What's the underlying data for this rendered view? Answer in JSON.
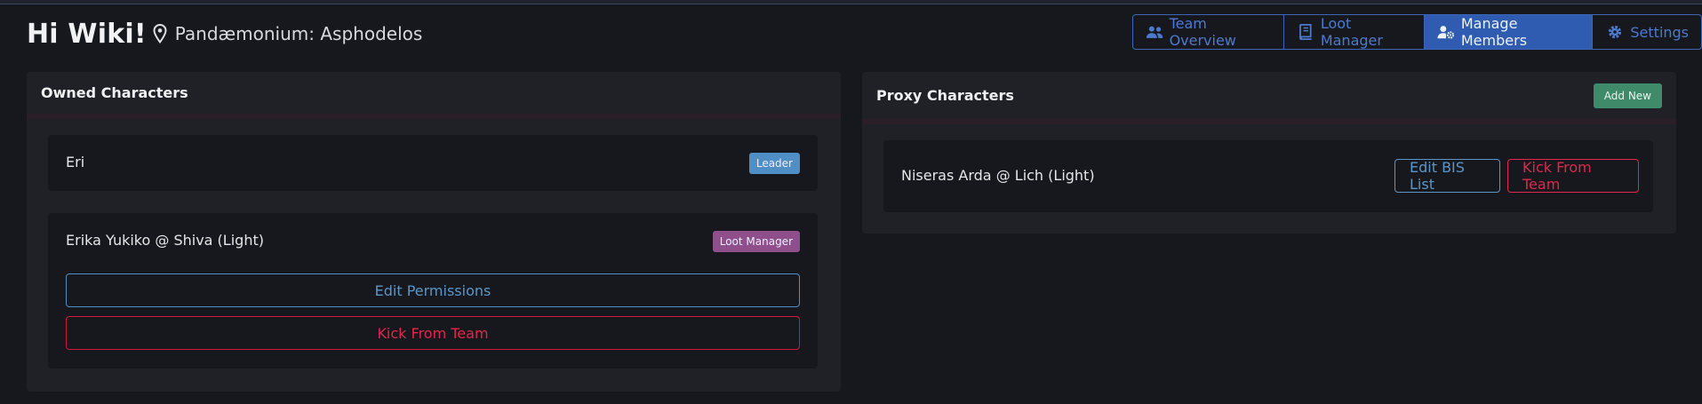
{
  "header": {
    "greeting": "Hi Wiki!",
    "location_icon": "map-pin-icon",
    "team_name": "Pandæmonium: Asphodelos"
  },
  "nav": {
    "tabs": [
      {
        "label": "Team Overview",
        "icon": "users-icon",
        "active": false
      },
      {
        "label": "Loot Manager",
        "icon": "book-icon",
        "active": false
      },
      {
        "label": "Manage Members",
        "icon": "user-cog-icon",
        "active": true
      },
      {
        "label": "Settings",
        "icon": "gear-icon",
        "active": false
      }
    ]
  },
  "owned": {
    "title": "Owned Characters",
    "characters": [
      {
        "name": "Eri",
        "badge": "Leader"
      },
      {
        "name": "Erika Yukiko @ Shiva (Light)",
        "badge": "Loot Manager",
        "edit_label": "Edit Permissions",
        "kick_label": "Kick From Team"
      }
    ]
  },
  "proxy": {
    "title": "Proxy Characters",
    "add_label": "Add New",
    "characters": [
      {
        "name": "Niseras Arda @ Lich (Light)",
        "edit_label": "Edit BIS List",
        "kick_label": "Kick From Team"
      }
    ]
  },
  "colors": {
    "accent": "#2f5bb0",
    "danger": "#d0173e",
    "info": "#4f8fc5",
    "success": "#3f8a68",
    "loot_badge": "#8e4f8c"
  }
}
